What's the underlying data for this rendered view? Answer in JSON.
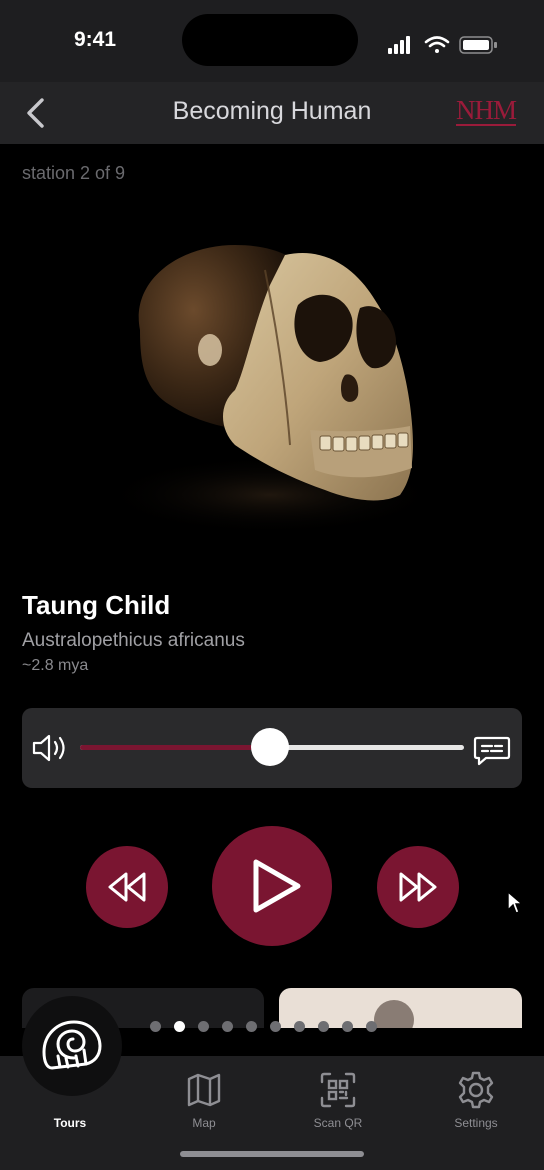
{
  "status_bar": {
    "time": "9:41"
  },
  "nav": {
    "title": "Becoming Human",
    "logo": "NHM"
  },
  "station_label": "station 2 of 9",
  "item": {
    "title": "Taung Child",
    "species": "Australopethicus africanus",
    "age": "~2.8 mya",
    "image": "skull-photo"
  },
  "audio": {
    "progress": 0.495
  },
  "carousel": {
    "count": 10,
    "active_index": 1
  },
  "tabs": [
    {
      "label": "Tours",
      "icon": "nautilus-icon",
      "active": true
    },
    {
      "label": "Map",
      "icon": "map-icon",
      "active": false
    },
    {
      "label": "Scan QR",
      "icon": "qr-scan-icon",
      "active": false
    },
    {
      "label": "Settings",
      "icon": "gear-icon",
      "active": false
    }
  ],
  "colors": {
    "accent": "#7a1531",
    "background": "#000000",
    "panel": "#2a2a2c"
  }
}
